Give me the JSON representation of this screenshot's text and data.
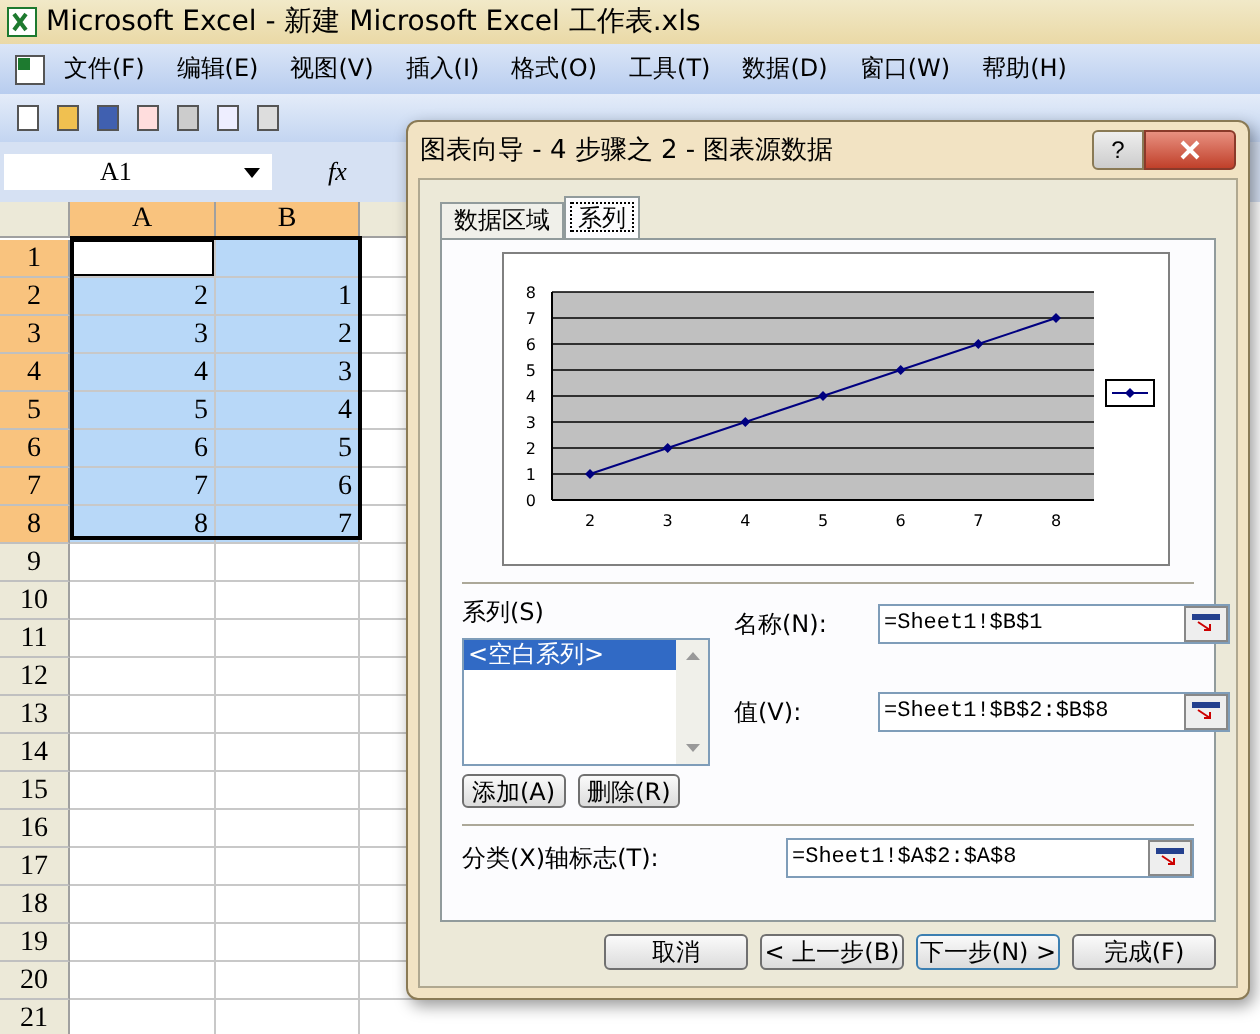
{
  "window": {
    "title": "Microsoft Excel - 新建 Microsoft Excel 工作表.xls"
  },
  "menu": [
    "文件(F)",
    "编辑(E)",
    "视图(V)",
    "插入(I)",
    "格式(O)",
    "工具(T)",
    "数据(D)",
    "窗口(W)",
    "帮助(H)"
  ],
  "formula_bar": {
    "name_box": "A1",
    "fx": "fx"
  },
  "sheet": {
    "columns": [
      {
        "label": "A",
        "selected": true
      },
      {
        "label": "B",
        "selected": true
      }
    ],
    "rows": [
      {
        "label": "1",
        "cells": [
          {
            "active": true
          },
          {
            "selected": true
          }
        ]
      },
      {
        "label": "2",
        "cells": [
          {
            "value": "2",
            "selected": true,
            "active": false
          },
          {
            "value": "1",
            "selected": true,
            "active": false
          }
        ]
      },
      {
        "label": "3",
        "cells": [
          {
            "value": "3",
            "selected": true,
            "active": false
          },
          {
            "value": "2",
            "selected": true,
            "active": false
          }
        ]
      },
      {
        "label": "4",
        "cells": [
          {
            "value": "4",
            "selected": true,
            "active": false
          },
          {
            "value": "3",
            "selected": true,
            "active": false
          }
        ]
      },
      {
        "label": "5",
        "cells": [
          {
            "value": "5",
            "selected": true,
            "active": false
          },
          {
            "value": "4",
            "selected": true,
            "active": false
          }
        ]
      },
      {
        "label": "6",
        "cells": [
          {
            "value": "6",
            "selected": true,
            "active": false
          },
          {
            "value": "5",
            "selected": true,
            "active": false
          }
        ]
      },
      {
        "label": "7",
        "cells": [
          {
            "value": "7",
            "selected": true,
            "active": false
          },
          {
            "value": "6",
            "selected": true,
            "active": false
          }
        ]
      },
      {
        "label": "8",
        "cells": [
          {
            "value": "8",
            "selected": true,
            "active": false
          },
          {
            "value": "7",
            "selected": true,
            "active": false
          }
        ]
      },
      {
        "label": "9",
        "cells": [
          {
            "selected": false,
            "active": false
          },
          {
            "selected": false,
            "active": false
          }
        ]
      },
      {
        "label": "10",
        "cells": [
          {
            "selected": false,
            "active": false
          },
          {
            "selected": false,
            "active": false
          }
        ]
      },
      {
        "label": "11",
        "cells": [
          {
            "selected": false,
            "active": false
          },
          {
            "selected": false,
            "active": false
          }
        ]
      },
      {
        "label": "12",
        "cells": [
          {
            "selected": false,
            "active": false
          },
          {
            "selected": false,
            "active": false
          }
        ]
      },
      {
        "label": "13",
        "cells": [
          {
            "selected": false,
            "active": false
          },
          {
            "selected": false,
            "active": false
          }
        ]
      },
      {
        "label": "14",
        "cells": [
          {
            "selected": false,
            "active": false
          },
          {
            "selected": false,
            "active": false
          }
        ]
      },
      {
        "label": "15",
        "cells": [
          {
            "selected": false,
            "active": false
          },
          {
            "selected": false,
            "active": false
          }
        ]
      },
      {
        "label": "16",
        "cells": [
          {
            "selected": false,
            "active": false
          },
          {
            "selected": false,
            "active": false
          }
        ]
      },
      {
        "label": "17",
        "cells": [
          {
            "selected": false,
            "active": false
          },
          {
            "selected": false,
            "active": false
          }
        ]
      },
      {
        "label": "18",
        "cells": [
          {
            "selected": false,
            "active": false
          },
          {
            "selected": false,
            "active": false
          }
        ]
      },
      {
        "label": "19",
        "cells": [
          {
            "selected": false,
            "active": false
          },
          {
            "selected": false,
            "active": false
          }
        ]
      },
      {
        "label": "20",
        "cells": [
          {
            "selected": false,
            "active": false
          },
          {
            "selected": false,
            "active": false
          }
        ]
      },
      {
        "label": "21",
        "cells": [
          {
            "selected": false,
            "active": false
          },
          {
            "selected": false,
            "active": false
          }
        ]
      }
    ]
  },
  "dialog": {
    "title": "图表向导 - 4 步骤之 2 - 图表源数据",
    "help": "?",
    "tabs": [
      {
        "label": "数据区域",
        "selected": false
      },
      {
        "label": "系列",
        "selected": true
      }
    ],
    "chart_data": {
      "type": "line",
      "categories": [
        "2",
        "3",
        "4",
        "5",
        "6",
        "7",
        "8"
      ],
      "series": [
        {
          "color": "#000080",
          "marker": "diamond",
          "values": [
            1,
            2,
            3,
            4,
            5,
            6,
            7
          ]
        }
      ],
      "ylim": [
        0,
        8
      ],
      "yticks": [
        0,
        1,
        2,
        3,
        4,
        5,
        6,
        7,
        8
      ],
      "grid": true
    },
    "series_label": "系列(S)",
    "series_list": [
      {
        "label": "<空白系列>",
        "selected": true
      }
    ],
    "add_button": "添加(A)",
    "remove_button": "删除(R)",
    "name_label": "名称(N):",
    "name_value": "=Sheet1!$B$1",
    "values_label": "值(V):",
    "values_value": "=Sheet1!$B$2:$B$8",
    "category_label": "分类(X)轴标志(T):",
    "category_value": "=Sheet1!$A$2:$A$8",
    "buttons": [
      "取消",
      "< 上一步(B)",
      "下一步(N) >",
      "完成(F)"
    ]
  }
}
